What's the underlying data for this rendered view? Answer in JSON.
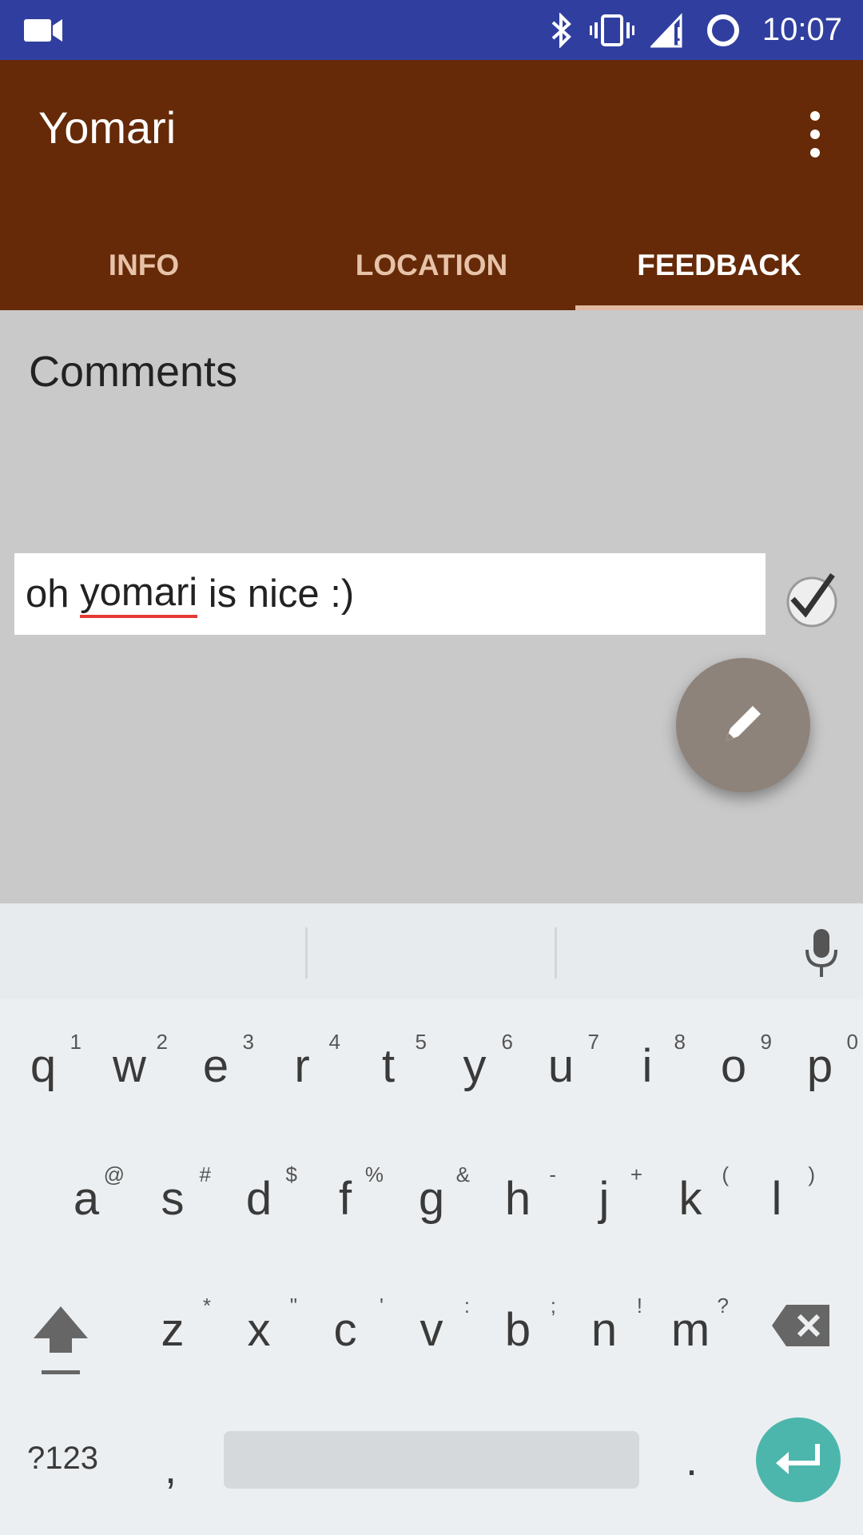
{
  "status_bar": {
    "time": "10:07",
    "icons": [
      "video-icon",
      "bluetooth-icon",
      "vibrate-icon",
      "signal-icon",
      "sync-icon"
    ]
  },
  "app_bar": {
    "title": "Yomari",
    "overflow_icon": "more-vert-icon",
    "tabs": [
      {
        "label": "INFO",
        "active": false
      },
      {
        "label": "LOCATION",
        "active": false
      },
      {
        "label": "FEEDBACK",
        "active": true
      }
    ]
  },
  "content": {
    "heading": "Comments",
    "comment_input": {
      "prefix": "oh ",
      "misspelled": "yomari",
      "suffix": " is nice :)"
    },
    "submit_icon": "check-icon",
    "fab_icon": "pencil-icon"
  },
  "keyboard": {
    "row1": [
      {
        "l": "q",
        "h": "1"
      },
      {
        "l": "w",
        "h": "2"
      },
      {
        "l": "e",
        "h": "3"
      },
      {
        "l": "r",
        "h": "4"
      },
      {
        "l": "t",
        "h": "5"
      },
      {
        "l": "y",
        "h": "6"
      },
      {
        "l": "u",
        "h": "7"
      },
      {
        "l": "i",
        "h": "8"
      },
      {
        "l": "o",
        "h": "9"
      },
      {
        "l": "p",
        "h": "0"
      }
    ],
    "row2": [
      {
        "l": "a",
        "h": "@"
      },
      {
        "l": "s",
        "h": "#"
      },
      {
        "l": "d",
        "h": "$"
      },
      {
        "l": "f",
        "h": "%"
      },
      {
        "l": "g",
        "h": "&"
      },
      {
        "l": "h",
        "h": "-"
      },
      {
        "l": "j",
        "h": "+"
      },
      {
        "l": "k",
        "h": "("
      },
      {
        "l": "l",
        "h": ")"
      }
    ],
    "row3": [
      {
        "l": "z",
        "h": "*"
      },
      {
        "l": "x",
        "h": "\""
      },
      {
        "l": "c",
        "h": "'"
      },
      {
        "l": "v",
        "h": ":"
      },
      {
        "l": "b",
        "h": ";"
      },
      {
        "l": "n",
        "h": "!"
      },
      {
        "l": "m",
        "h": "?"
      }
    ],
    "symbols_key": "?123",
    "comma_key": ",",
    "period_key": ".",
    "shift_icon": "shift-icon",
    "backspace_icon": "backspace-icon",
    "enter_icon": "enter-icon",
    "mic_icon": "mic-icon"
  }
}
